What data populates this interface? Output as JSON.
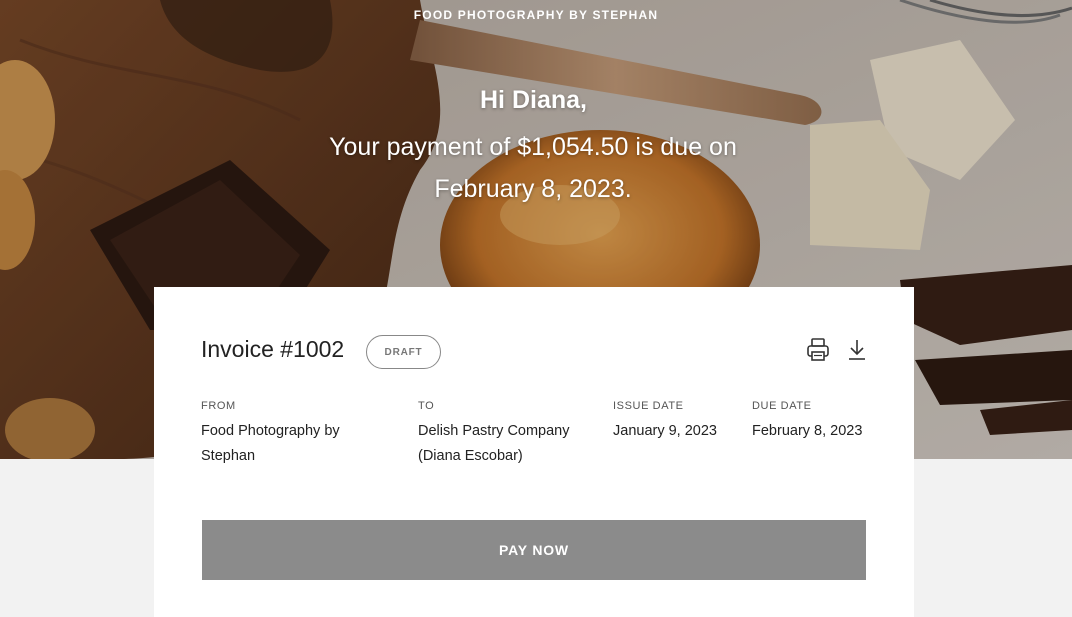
{
  "hero": {
    "brand": "FOOD PHOTOGRAPHY BY STEPHAN",
    "greeting": "Hi Diana,",
    "message": "Your payment of $1,054.50 is due on February 8, 2023."
  },
  "invoice": {
    "title": "Invoice #1002",
    "status_badge": "DRAFT",
    "icons": [
      "printer-icon",
      "download-icon"
    ],
    "details": {
      "from_label": "FROM",
      "from_value": "Food Photography by Stephan",
      "to_label": "TO",
      "to_value": "Delish Pastry Company (Diana Escobar)",
      "issue_label": "ISSUE DATE",
      "issue_value": "January 9, 2023",
      "due_label": "DUE DATE",
      "due_value": "February 8, 2023"
    },
    "pay_button": "PAY NOW"
  },
  "colors": {
    "page_background": "#f2f2f2",
    "card_background": "#ffffff",
    "pay_button": "#8b8b8b",
    "text_primary": "#222222"
  }
}
